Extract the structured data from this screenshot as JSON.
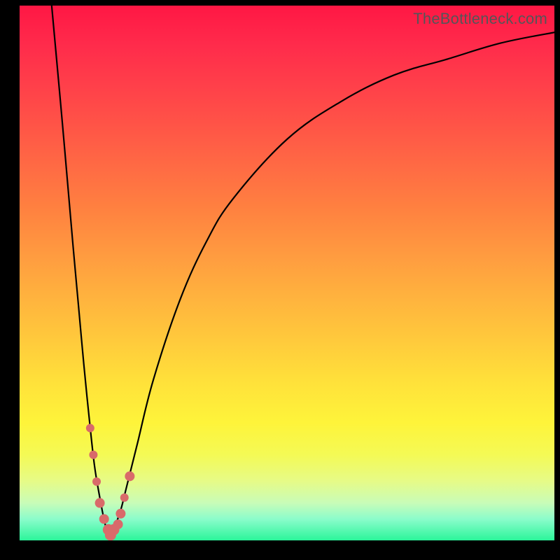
{
  "watermark": "TheBottleneck.com",
  "colors": {
    "curve": "#000000",
    "marker": "#d96a6a",
    "marker_stroke": "#c55a5a"
  },
  "chart_data": {
    "type": "line",
    "title": "",
    "xlabel": "",
    "ylabel": "",
    "xlim": [
      0,
      100
    ],
    "ylim": [
      0,
      100
    ],
    "series": [
      {
        "name": "left-branch",
        "x": [
          6,
          8,
          10,
          11,
          12,
          13,
          14,
          15,
          16,
          17
        ],
        "y": [
          100,
          78,
          55,
          44,
          33,
          23,
          14,
          8,
          3,
          0
        ]
      },
      {
        "name": "right-branch",
        "x": [
          17,
          18,
          19,
          20,
          22,
          25,
          30,
          35,
          40,
          50,
          60,
          70,
          80,
          90,
          100
        ],
        "y": [
          0,
          3,
          6,
          10,
          18,
          30,
          45,
          56,
          64,
          75,
          82,
          87,
          90,
          93,
          95
        ]
      }
    ],
    "markers": {
      "name": "highlighted-points",
      "points": [
        {
          "x": 13.2,
          "y": 21,
          "r": 6
        },
        {
          "x": 13.8,
          "y": 16,
          "r": 6
        },
        {
          "x": 14.4,
          "y": 11,
          "r": 6
        },
        {
          "x": 15.0,
          "y": 7,
          "r": 7
        },
        {
          "x": 15.8,
          "y": 4,
          "r": 7
        },
        {
          "x": 16.6,
          "y": 2,
          "r": 8
        },
        {
          "x": 17.0,
          "y": 1,
          "r": 8
        },
        {
          "x": 17.6,
          "y": 2,
          "r": 8
        },
        {
          "x": 18.4,
          "y": 3,
          "r": 7
        },
        {
          "x": 18.9,
          "y": 5,
          "r": 7
        },
        {
          "x": 19.6,
          "y": 8,
          "r": 6
        },
        {
          "x": 20.6,
          "y": 12,
          "r": 7
        }
      ]
    }
  }
}
